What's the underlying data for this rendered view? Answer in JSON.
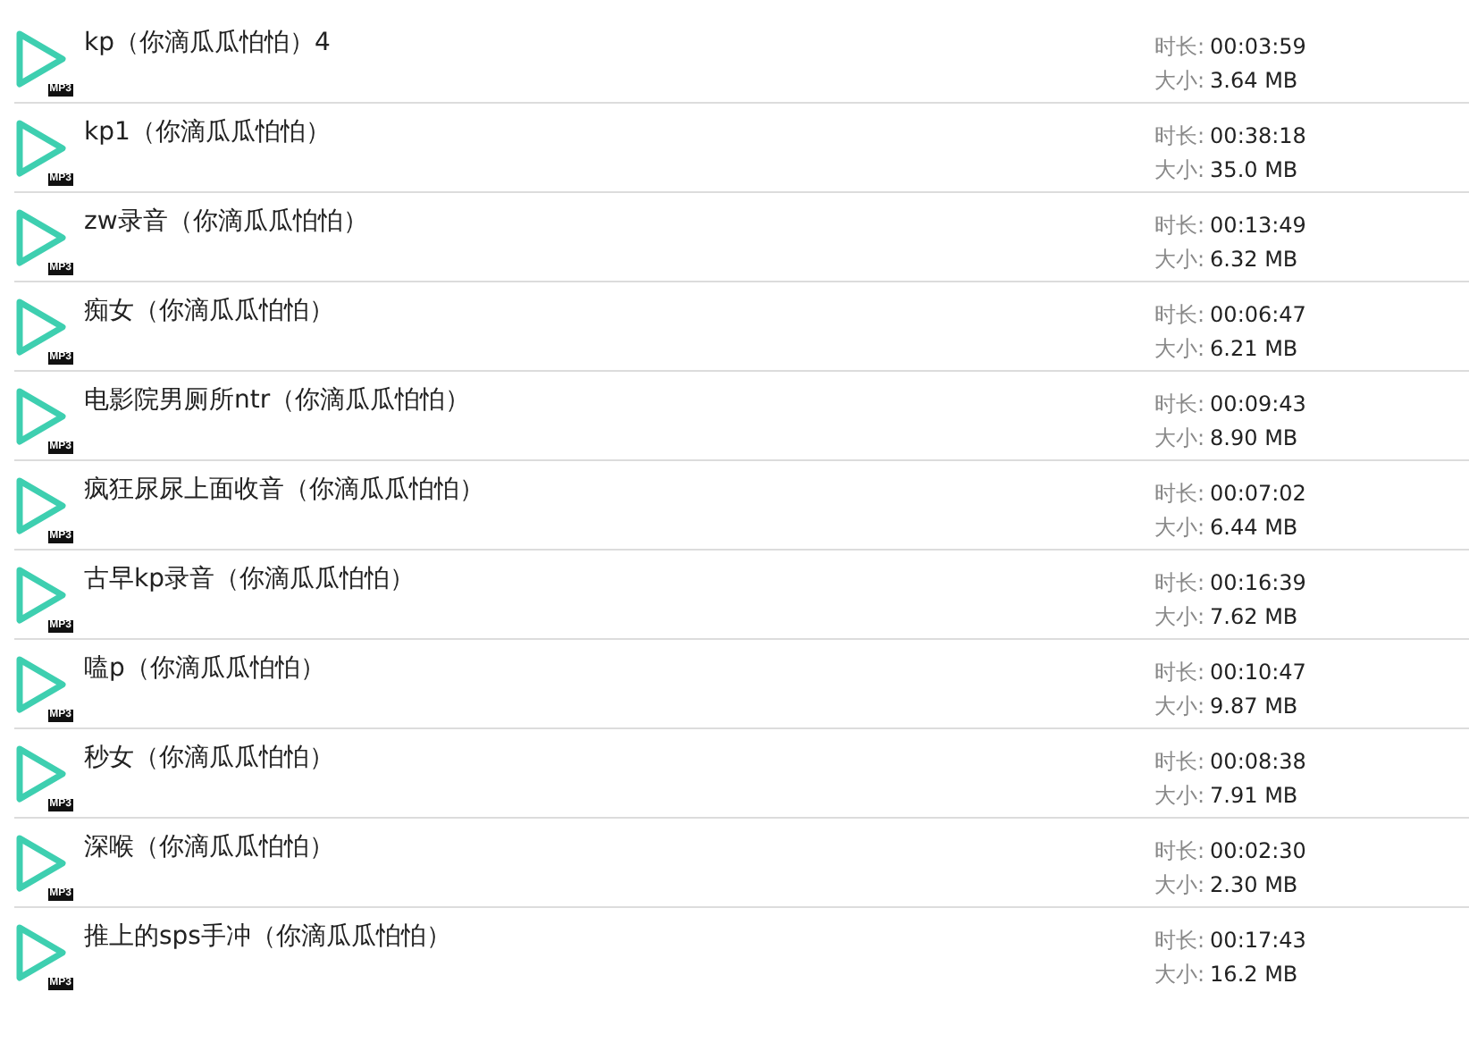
{
  "files": [
    {
      "name": "kp（你滴瓜瓜怕怕）4",
      "badge": "MP3",
      "duration_label": "时长:",
      "duration": "00:03:59",
      "size_label": "大小:",
      "size": "3.64 MB"
    },
    {
      "name": "kp1（你滴瓜瓜怕怕）",
      "badge": "MP3",
      "duration_label": "时长:",
      "duration": "00:38:18",
      "size_label": "大小:",
      "size": "35.0 MB"
    },
    {
      "name": "zw录音（你滴瓜瓜怕怕）",
      "badge": "MP3",
      "duration_label": "时长:",
      "duration": "00:13:49",
      "size_label": "大小:",
      "size": "6.32 MB"
    },
    {
      "name": "痴女（你滴瓜瓜怕怕）",
      "badge": "MP3",
      "duration_label": "时长:",
      "duration": "00:06:47",
      "size_label": "大小:",
      "size": "6.21 MB"
    },
    {
      "name": "电影院男厕所ntr（你滴瓜瓜怕怕）",
      "badge": "MP3",
      "duration_label": "时长:",
      "duration": "00:09:43",
      "size_label": "大小:",
      "size": "8.90 MB"
    },
    {
      "name": "疯狂尿尿上面收音（你滴瓜瓜怕怕）",
      "badge": "MP3",
      "duration_label": "时长:",
      "duration": "00:07:02",
      "size_label": "大小:",
      "size": "6.44 MB"
    },
    {
      "name": "古早kp录音（你滴瓜瓜怕怕）",
      "badge": "MP3",
      "duration_label": "时长:",
      "duration": "00:16:39",
      "size_label": "大小:",
      "size": "7.62 MB"
    },
    {
      "name": "嗑p（你滴瓜瓜怕怕）",
      "badge": "MP3",
      "duration_label": "时长:",
      "duration": "00:10:47",
      "size_label": "大小:",
      "size": "9.87 MB"
    },
    {
      "name": "秒女（你滴瓜瓜怕怕）",
      "badge": "MP3",
      "duration_label": "时长:",
      "duration": "00:08:38",
      "size_label": "大小:",
      "size": "7.91 MB"
    },
    {
      "name": "深喉（你滴瓜瓜怕怕）",
      "badge": "MP3",
      "duration_label": "时长:",
      "duration": "00:02:30",
      "size_label": "大小:",
      "size": "2.30 MB"
    },
    {
      "name": "推上的sps手冲（你滴瓜瓜怕怕）",
      "badge": "MP3",
      "duration_label": "时长:",
      "duration": "00:17:43",
      "size_label": "大小:",
      "size": "16.2 MB"
    }
  ]
}
